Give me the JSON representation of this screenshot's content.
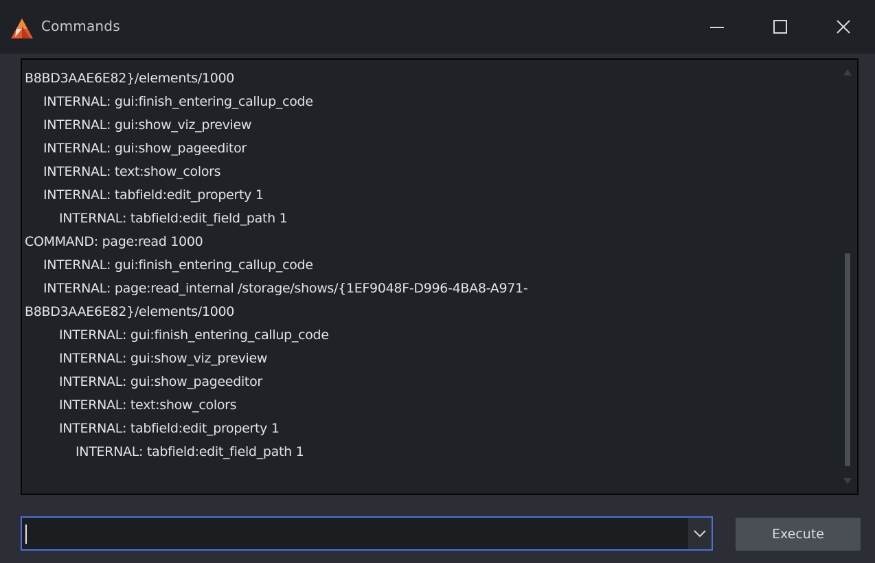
{
  "window": {
    "title": "Commands",
    "app_icon": "vizrt-triangle-logo-icon",
    "controls": [
      "minimize-icon",
      "maximize-icon",
      "close-icon"
    ]
  },
  "log": {
    "lines": [
      {
        "text": "B8BD3AAE6E82}/elements/1000",
        "indent": 0
      },
      {
        "text": "INTERNAL: gui:finish_entering_callup_code",
        "indent": 1
      },
      {
        "text": "INTERNAL: gui:show_viz_preview",
        "indent": 1
      },
      {
        "text": "INTERNAL: gui:show_pageeditor",
        "indent": 1
      },
      {
        "text": "INTERNAL: text:show_colors",
        "indent": 1
      },
      {
        "text": "INTERNAL: tabfield:edit_property 1",
        "indent": 1
      },
      {
        "text": "INTERNAL: tabfield:edit_field_path 1",
        "indent": 2
      },
      {
        "text": "COMMAND: page:read 1000",
        "indent": 0
      },
      {
        "text": "INTERNAL: gui:finish_entering_callup_code",
        "indent": 1
      },
      {
        "text": "INTERNAL: page:read_internal /storage/shows/{1EF9048F-D996-4BA8-A971-",
        "indent": 1
      },
      {
        "text": "B8BD3AAE6E82}/elements/1000",
        "indent": 0
      },
      {
        "text": "INTERNAL: gui:finish_entering_callup_code",
        "indent": 2
      },
      {
        "text": "INTERNAL: gui:show_viz_preview",
        "indent": 2
      },
      {
        "text": "INTERNAL: gui:show_pageeditor",
        "indent": 2
      },
      {
        "text": "INTERNAL: text:show_colors",
        "indent": 2
      },
      {
        "text": "INTERNAL: tabfield:edit_property 1",
        "indent": 2
      },
      {
        "text": "INTERNAL: tabfield:edit_field_path 1",
        "indent": 3
      }
    ]
  },
  "command_input": {
    "value": "",
    "placeholder": "",
    "dropdown_icon": "chevron-down-icon"
  },
  "execute_button": {
    "label": "Execute"
  },
  "colors": {
    "focus_border": "#4e6fe0",
    "background": "#2b2e34",
    "titlebar": "#1e2125",
    "log_background": "#1f2226",
    "button": "#4a4e55"
  }
}
